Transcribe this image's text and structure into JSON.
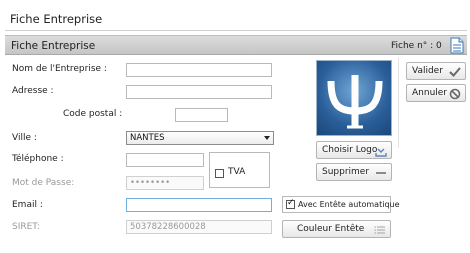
{
  "window": {
    "title": "Fiche Entreprise"
  },
  "header": {
    "title": "Fiche Entreprise",
    "fiche_number": "Fiche  n° : 0",
    "doc_icon": "document-icon"
  },
  "form": {
    "nom": {
      "label": "Nom de l'Entreprise :",
      "value": ""
    },
    "adresse": {
      "label": "Adresse :",
      "value": ""
    },
    "code_postal": {
      "label": "Code postal :",
      "value": ""
    },
    "ville": {
      "label": "Ville :",
      "value": "NANTES"
    },
    "telephone": {
      "label": "Téléphone :",
      "value": ""
    },
    "mot_de_passe": {
      "label": "Mot de Passe:",
      "value": "••••••••"
    },
    "email": {
      "label": "Email :",
      "value": ""
    },
    "siret": {
      "label": "SIRET:",
      "value": "50378228600028"
    },
    "tva": {
      "label": "TVA",
      "checked": false
    }
  },
  "logo": {
    "icon": "psi-logo-icon"
  },
  "buttons": {
    "valider": "Valider",
    "annuler": "Annuler",
    "choisir_logo": "Choisir Logo",
    "supprimer": "Supprimer",
    "couleur_entete": "Couleur Entête"
  },
  "entete": {
    "label": "Avec Entête automatique",
    "checked": true
  },
  "colors": {
    "accent": "#2a5f9a",
    "header_bar": "#cfcfcf",
    "focus_border": "#6fb0e0"
  }
}
